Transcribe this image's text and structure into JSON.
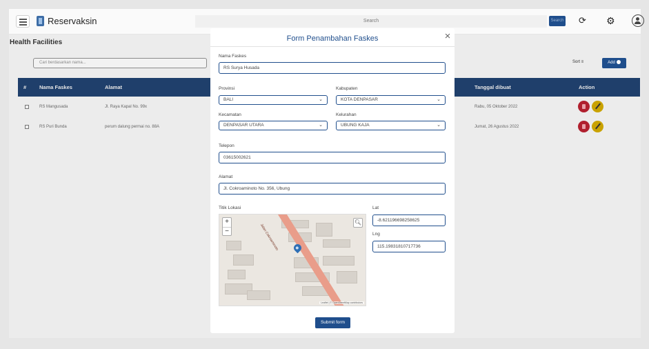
{
  "app": {
    "brand": "Reservaksin",
    "search_placeholder": "Search",
    "search_button": "Search"
  },
  "page": {
    "title": "Health Facilities",
    "search_placeholder": "Cari berdasarkan nama...",
    "sort_label": "Sort ≡",
    "add_label": "Add"
  },
  "table": {
    "headers": [
      "#",
      "Nama Faskes",
      "Alamat",
      "Tanggal dibuat",
      "Action"
    ],
    "rows": [
      {
        "name": "RS Mangusada",
        "address": "Jl. Raya Kapal No. 99x",
        "created": "Rabu, 05 Oktober 2022"
      },
      {
        "name": "RS Puri Bunda",
        "address": "perum dalung permai no. 88A",
        "created": "Jumat, 26 Agustus 2022"
      }
    ]
  },
  "modal": {
    "title": "Form Penambahan Faskes",
    "close_glyph": "×",
    "nama_label": "Nama Faskes",
    "nama_value": "RS Surya Husada",
    "provinsi_label": "Provinsi",
    "provinsi_value": "BALI",
    "kabupaten_label": "Kabupaten",
    "kabupaten_value": "KOTA DENPASAR",
    "kecamatan_label": "Kecamatan",
    "kecamatan_value": "DENPASAR UTARA",
    "kelurahan_label": "Kelurahan",
    "kelurahan_value": "UBUNG KAJA",
    "telepon_label": "Telepon",
    "telepon_value": "03615002621",
    "alamat_label": "Alamat",
    "alamat_value": "Jl. Cokroaminoto No. 356, Ubung",
    "titik_label": "Titik Lokasi",
    "lat_label": "Lat",
    "lat_value": "-8.621196698258625",
    "lng_label": "Lng",
    "lng_value": "115.19831810717736",
    "map_road_label": "Jalan Cokroaminoto",
    "map_attribution": "Leaflet | © OpenStreetMap contributors",
    "submit_label": "Submit form"
  },
  "icons": {
    "menu": "menu-icon",
    "refresh": "refresh-icon",
    "settings": "gear-icon",
    "user": "user-avatar-icon"
  },
  "colors": {
    "primary": "#1f4e8c",
    "table_header": "#1f3f6b",
    "delete": "#b01f2e",
    "edit": "#c9a200",
    "road": "#e99d8a",
    "pin": "#2f6fb5"
  }
}
